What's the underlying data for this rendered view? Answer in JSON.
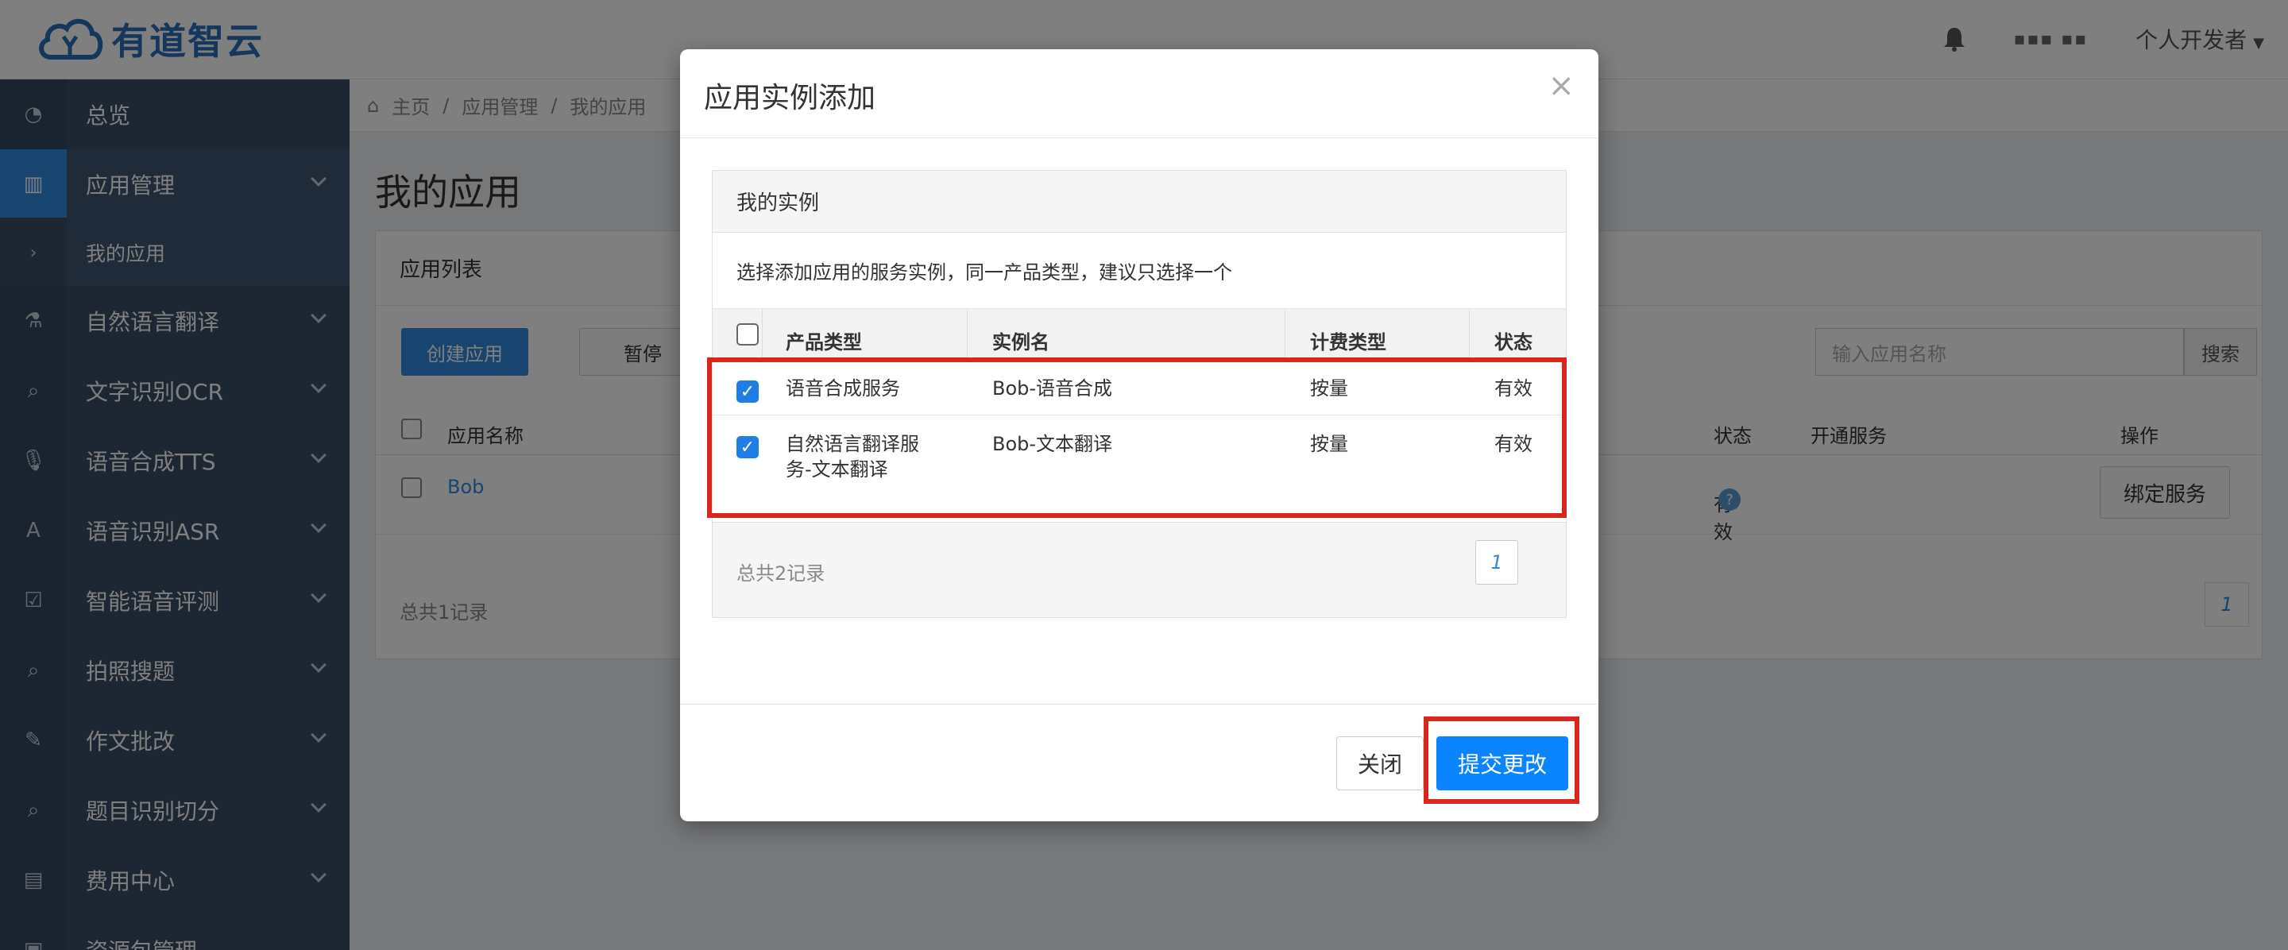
{
  "header": {
    "brand": "有道智云",
    "user_masked": "▪▪▪ ▪▪",
    "developer_menu": "个人开发者"
  },
  "sidebar": {
    "items": [
      {
        "label": "总览",
        "icon": "dashboard-icon"
      },
      {
        "label": "应用管理",
        "icon": "app-grid-icon"
      },
      {
        "label": "我的应用",
        "icon": "chevron-right-icon"
      },
      {
        "label": "自然语言翻译",
        "icon": "flask-icon"
      },
      {
        "label": "文字识别OCR",
        "icon": "search-icon"
      },
      {
        "label": "语音合成TTS",
        "icon": "microphone-icon"
      },
      {
        "label": "语音识别ASR",
        "icon": "font-a-icon"
      },
      {
        "label": "智能语音评测",
        "icon": "check-square-icon"
      },
      {
        "label": "拍照搜题",
        "icon": "search-icon"
      },
      {
        "label": "作文批改",
        "icon": "edit-icon"
      },
      {
        "label": "题目识别切分",
        "icon": "search-icon"
      },
      {
        "label": "费用中心",
        "icon": "bar-chart-icon"
      },
      {
        "label": "资源包管理",
        "icon": "package-icon"
      }
    ]
  },
  "breadcrumb": {
    "home": "主页",
    "level1": "应用管理",
    "level2": "我的应用"
  },
  "main": {
    "title": "我的应用",
    "panel_title": "应用列表",
    "create_button": "创建应用",
    "pause_button": "暂停",
    "search_placeholder": "输入应用名称",
    "search_button": "搜索",
    "columns": {
      "name": "应用名称",
      "status": "状态",
      "services": "开通服务",
      "actions": "操作"
    },
    "row": {
      "name": "Bob",
      "status": "有效",
      "help": "?",
      "bind_button": "绑定服务"
    },
    "total": "总共1记录",
    "page": "1"
  },
  "modal": {
    "title": "应用实例添加",
    "close_symbol": "×",
    "panel_title": "我的实例",
    "description": "选择添加应用的服务实例，同一产品类型，建议只选择一个",
    "columns": {
      "product_type": "产品类型",
      "instance_name": "实例名",
      "billing_type": "计费类型",
      "status": "状态"
    },
    "rows": [
      {
        "checked": true,
        "product_type": "语音合成服务",
        "instance_name": "Bob-语音合成",
        "billing_type": "按量",
        "status": "有效"
      },
      {
        "checked": true,
        "product_type": "自然语言翻译服务-文本翻译",
        "product_type_line1": "自然语言翻译服",
        "product_type_line2": "务-文本翻译",
        "instance_name": "Bob-文本翻译",
        "billing_type": "按量",
        "status": "有效"
      }
    ],
    "total": "总共2记录",
    "page": "1",
    "close_button": "关闭",
    "submit_button": "提交更改"
  },
  "colors": {
    "sidebar_bg": "#3a4e66",
    "accent_blue": "#2f8ae0",
    "submit_blue": "#0a84ff",
    "annotation_red": "#d9261c"
  }
}
